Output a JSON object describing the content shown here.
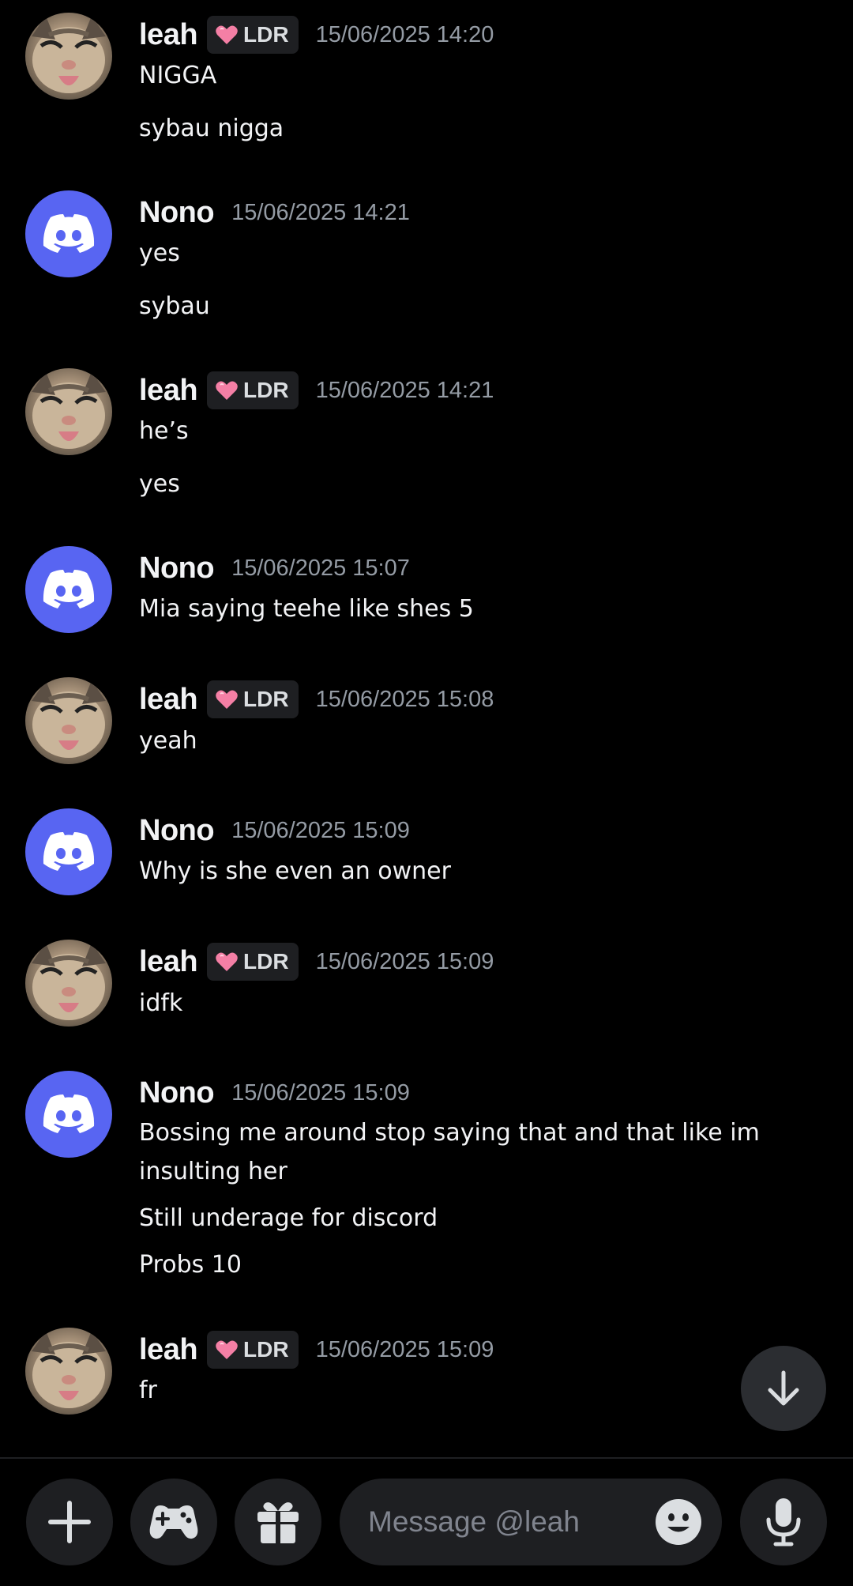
{
  "messages": [
    {
      "author": "leah",
      "tag": "LDR",
      "timestamp": "15/06/2025 14:20",
      "lines": [
        "NIGGA",
        "sybau nigga"
      ]
    },
    {
      "author": "Nono",
      "timestamp": "15/06/2025 14:21",
      "lines": [
        "yes",
        "sybau"
      ]
    },
    {
      "author": "leah",
      "tag": "LDR",
      "timestamp": "15/06/2025 14:21",
      "lines": [
        "he’s",
        "yes"
      ]
    },
    {
      "author": "Nono",
      "timestamp": "15/06/2025 15:07",
      "lines": [
        "Mia saying teehe like shes 5"
      ]
    },
    {
      "author": "leah",
      "tag": "LDR",
      "timestamp": "15/06/2025 15:08",
      "lines": [
        "yeah"
      ]
    },
    {
      "author": "Nono",
      "timestamp": "15/06/2025 15:09",
      "lines": [
        "Why is she even an owner"
      ]
    },
    {
      "author": "leah",
      "tag": "LDR",
      "timestamp": "15/06/2025 15:09",
      "lines": [
        "idfk"
      ]
    },
    {
      "author": "Nono",
      "timestamp": "15/06/2025 15:09",
      "lines": [
        "Bossing me around stop saying that and that like im",
        "insulting her",
        "Still underage for discord",
        "Probs 10"
      ]
    },
    {
      "author": "leah",
      "tag": "LDR",
      "timestamp": "15/06/2025 15:09",
      "lines": [
        "fr"
      ]
    }
  ],
  "composer": {
    "placeholder": "Message @leah"
  },
  "icons": {
    "add": "plus-icon",
    "games": "gamepad-icon",
    "gift": "gift-icon",
    "emoji": "emoji-icon",
    "voice": "microphone-icon",
    "jump": "arrow-down-icon",
    "tag_badge": "heart-icon",
    "discord_avatar": "discord-logo-icon"
  },
  "colors": {
    "background": "#000000",
    "blurple": "#5865f2",
    "surface": "#1e1f22",
    "timestamp": "#949ba4",
    "text": "#f2f3f5"
  }
}
